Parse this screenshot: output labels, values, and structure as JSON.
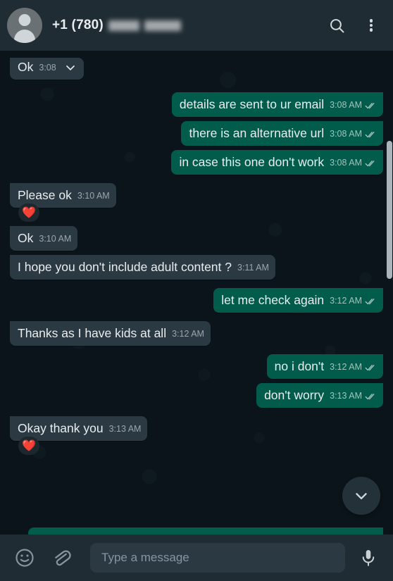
{
  "header": {
    "avatar_icon": "person-avatar-icon",
    "contact_prefix": "+1 (780)",
    "search_icon": "search-icon",
    "menu_icon": "overflow-menu-icon"
  },
  "chat": {
    "messages": [
      {
        "id": "m1",
        "direction": "in",
        "text": "Ok",
        "time": "3:08",
        "clipped": true,
        "menu_icon": "chevron-down-icon",
        "reaction": null
      },
      {
        "id": "m2",
        "direction": "out",
        "text": "details are sent to ur email",
        "time": "3:08 AM",
        "status_icon": "double-check-icon",
        "reaction": null
      },
      {
        "id": "m3",
        "direction": "out",
        "text": "there is an alternative url",
        "time": "3:08 AM",
        "status_icon": "double-check-icon",
        "reaction": null
      },
      {
        "id": "m4",
        "direction": "out",
        "text": "in case this one don't work",
        "time": "3:08 AM",
        "status_icon": "double-check-icon",
        "reaction": null
      },
      {
        "id": "m5",
        "direction": "in",
        "text": "Please ok",
        "time": "3:10 AM",
        "reaction": "❤️"
      },
      {
        "id": "m6",
        "direction": "in",
        "text": "Ok",
        "time": "3:10 AM",
        "reaction": null
      },
      {
        "id": "m7",
        "direction": "in",
        "text": "I hope you don't include adult content ?",
        "time": "3:11 AM",
        "reaction": null
      },
      {
        "id": "m8",
        "direction": "out",
        "text": "let me check again",
        "time": "3:12 AM",
        "status_icon": "double-check-icon",
        "reaction": null
      },
      {
        "id": "m9",
        "direction": "in",
        "text": "Thanks as I have kids at all",
        "time": "3:12 AM",
        "reaction": null
      },
      {
        "id": "m10",
        "direction": "out",
        "text": "no i don't",
        "time": "3:12 AM",
        "status_icon": "double-check-icon",
        "reaction": null
      },
      {
        "id": "m11",
        "direction": "out",
        "text": "don't worry",
        "time": "3:13 AM",
        "status_icon": "double-check-icon",
        "reaction": null
      },
      {
        "id": "m12",
        "direction": "in",
        "text": "Okay thank you",
        "time": "3:13 AM",
        "reaction": "❤️"
      }
    ],
    "scroll_down_icon": "chevron-down-icon"
  },
  "footer": {
    "emoji_icon": "emoji-smiley-icon",
    "attach_icon": "paperclip-icon",
    "input_placeholder": "Type a message",
    "input_value": "",
    "mic_icon": "microphone-icon"
  },
  "colors": {
    "header_bg": "#202c33",
    "chat_bg": "#0b141a",
    "outgoing_bubble": "#025c4c",
    "incoming_bubble": "#2a3942",
    "text": "#e9edef",
    "meta_text": "#9aa6ac",
    "tick": "#a6c5bd"
  }
}
